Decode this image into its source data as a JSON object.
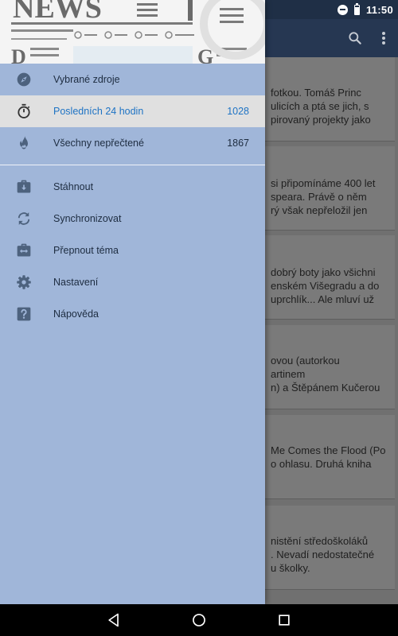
{
  "status_bar": {
    "time": "11:50",
    "icons": [
      "do-not-disturb-icon",
      "battery-icon"
    ]
  },
  "app_bar": {
    "icons": [
      "search-icon",
      "more-vert-icon"
    ]
  },
  "header": {
    "logo_text": "NEWS",
    "letter_d": "D",
    "letter_g": "G"
  },
  "drawer": {
    "items": [
      {
        "label": "Vybrané zdroje",
        "count": "",
        "icon": "compass-icon",
        "active": false
      },
      {
        "label": "Posledních 24 hodin",
        "count": "1028",
        "icon": "stopwatch-icon",
        "active": true
      },
      {
        "label": "Všechny nepřečtené",
        "count": "1867",
        "icon": "flame-icon",
        "active": false
      }
    ],
    "actions": [
      {
        "label": "Stáhnout",
        "icon": "download-briefcase-icon"
      },
      {
        "label": "Synchronizovat",
        "icon": "sync-icon"
      },
      {
        "label": "Přepnout téma",
        "icon": "switch-theme-icon"
      },
      {
        "label": "Nastavení",
        "icon": "gear-icon"
      },
      {
        "label": "Nápověda",
        "icon": "help-icon"
      }
    ]
  },
  "articles": [
    {
      "lines": [
        "fotkou. Tomáš Princ",
        "ulicích a ptá se jich, s",
        "pirovaný projekty jako"
      ]
    },
    {
      "lines": [
        "si připomínáme 400 let",
        "speara. Právě o něm",
        "rý však nepřeložil jen"
      ]
    },
    {
      "lines": [
        "dobrý boty jako všichni",
        "enském Višegradu a do",
        "uprchlík... Ale mluví už"
      ]
    },
    {
      "lines": [
        "ovou (autorkou",
        "artinem",
        "n) a Štěpánem Kučerou"
      ]
    },
    {
      "lines": [
        "Me Comes the Flood (Po",
        "o ohlasu. Druhá kniha",
        ""
      ]
    },
    {
      "lines": [
        "nistění středoškoláků",
        ". Nevadí nedostatečné",
        "u školky."
      ]
    }
  ],
  "nav_bar": {
    "buttons": [
      "back-button",
      "home-button",
      "recents-button"
    ]
  }
}
